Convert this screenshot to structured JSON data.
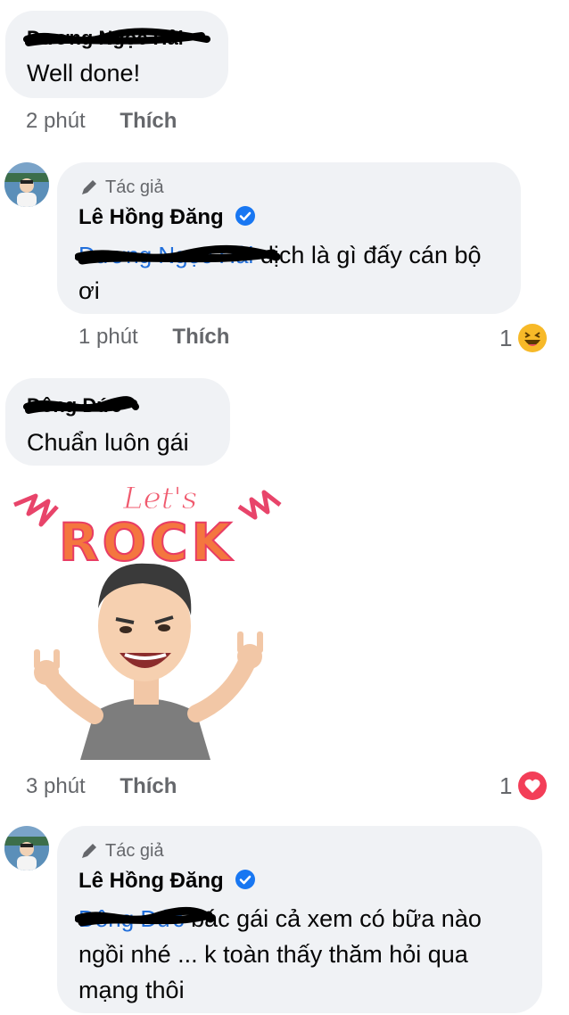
{
  "comments": [
    {
      "author": "Dương Ngọc Hải",
      "text": "Well done!",
      "time": "2 phút",
      "like_label": "Thích"
    },
    {
      "author_tag": "Tác giả",
      "author": "Lê Hồng Đăng",
      "mention": "Dương Ngọc Hải",
      "text": "dịch là gì đấy cán bộ ơi",
      "time": "1 phút",
      "like_label": "Thích",
      "reaction_count": "1",
      "reaction_icon": "haha-icon"
    },
    {
      "author": "Đông Đức",
      "text": "Chuẩn luôn gái",
      "sticker_text_line1": "Let's",
      "sticker_text_line2": "ROCK",
      "time": "3 phút",
      "like_label": "Thích",
      "reaction_count": "1",
      "reaction_icon": "love-icon"
    },
    {
      "author_tag": "Tác giả",
      "author": "Lê Hồng Đăng",
      "mention": "Đông Đức",
      "text": "bác gái cả xem có bữa nào ngồi nhé ... k toàn thấy thăm hỏi qua mạng thôi"
    }
  ],
  "colors": {
    "bubble": "#f0f2f5",
    "meta": "#65676b",
    "mention": "#216fdb",
    "verified": "#1877f2",
    "haha": "#f7b928",
    "love": "#f33e58"
  }
}
